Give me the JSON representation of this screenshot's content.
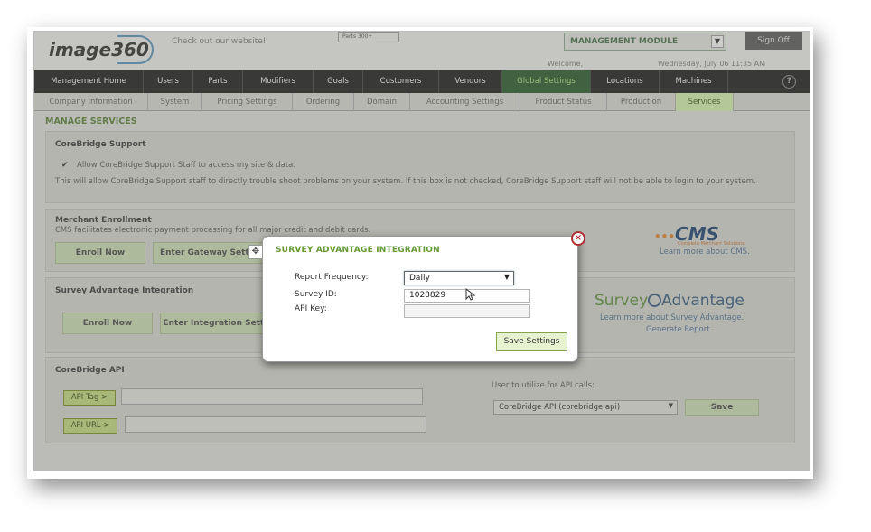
{
  "header": {
    "logo_text": "image360",
    "website_link": "Check out our website!",
    "ad_text": "Parts 300+",
    "module_select": "MANAGEMENT MODULE",
    "sign_off": "Sign Off",
    "welcome": "Welcome,",
    "datetime": "Wednesday, July 06  11:35 AM"
  },
  "nav": {
    "items": [
      "Management Home",
      "Users",
      "Parts",
      "Modifiers",
      "Goals",
      "Customers",
      "Vendors",
      "Global Settings",
      "Locations",
      "Machines"
    ],
    "active": "Global Settings"
  },
  "subnav": {
    "items": [
      "Company Information",
      "System",
      "Pricing Settings",
      "Ordering",
      "Domain",
      "Accounting Settings",
      "Product Status",
      "Production",
      "Services"
    ],
    "active": "Services"
  },
  "page": {
    "title": "MANAGE SERVICES",
    "support": {
      "heading": "CoreBridge Support",
      "checkbox_label": "Allow CoreBridge Support Staff to access my site & data.",
      "checked": true,
      "note": "This will allow CoreBridge Support staff to directly trouble shoot problems on your system. If this box is not checked, CoreBridge Support staff will not be able to login to your system."
    },
    "merchant": {
      "heading": "Merchant Enrollment",
      "desc": "CMS facilitates electronic payment processing for all major credit and debit cards.",
      "enroll_btn": "Enroll Now",
      "gateway_btn": "Enter Gateway Settings",
      "cms_logo": "CMS",
      "cms_tagline": "Complete Merchant Solutions",
      "cms_link": "Learn more about CMS."
    },
    "survey": {
      "heading": "Survey Advantage Integration",
      "enroll_btn": "Enroll Now",
      "integration_btn": "Enter Integration Settings",
      "logo_first": "Survey",
      "logo_second": "Advantage",
      "learn_link": "Learn more about Survey Advantage.",
      "report_link": "Generate Report"
    },
    "api": {
      "heading": "CoreBridge API",
      "tag_btn": "API Tag >",
      "url_btn": "API URL >",
      "user_label": "User to utilize for API calls:",
      "user_select": "CoreBridge API (corebridge.api)",
      "save_btn": "Save"
    }
  },
  "modal": {
    "title": "SURVEY ADVANTAGE INTEGRATION",
    "report_frequency_label": "Report Frequency:",
    "report_frequency_value": "Daily",
    "survey_id_label": "Survey ID:",
    "survey_id_value": "1028829",
    "api_key_label": "API Key:",
    "api_key_value": "",
    "save_btn": "Save Settings"
  },
  "colors": {
    "nav_bg": "#222222",
    "accent_green": "#669933",
    "active_tab": "#2d5a2d",
    "close_red": "#b03030"
  }
}
